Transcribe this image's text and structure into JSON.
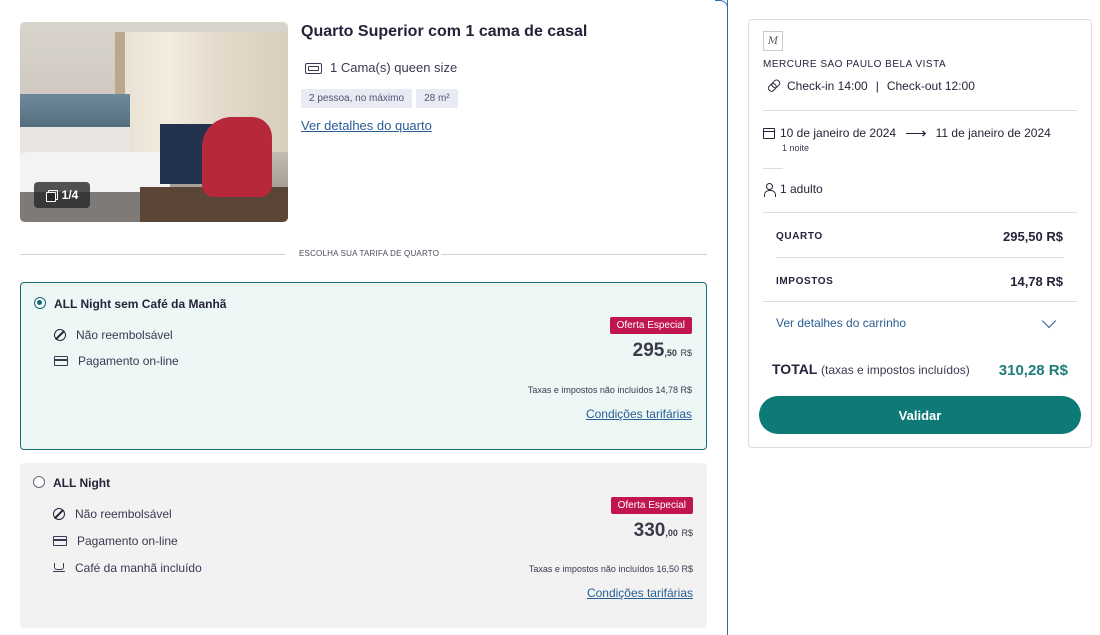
{
  "room": {
    "title": "Quarto Superior com 1 cama de casal",
    "bed": "1 Cama(s) queen size",
    "chips": [
      "2 pessoa, no máximo",
      "28 m²"
    ],
    "details_link": "Ver detalhes do quarto",
    "photo_counter": "1/4",
    "divider_label": "ESCOLHA SUA TARIFA DE QUARTO"
  },
  "rates": [
    {
      "name": "ALL Night sem Café da Manhã",
      "selected": true,
      "features": [
        "Não reembolsável",
        "Pagamento on-line"
      ],
      "badge": "Oferta Especial",
      "price_int": "295",
      "price_dec": ",50",
      "currency": "R$",
      "taxes_note": "Taxas e impostos não incluídos 14,78 R$",
      "conditions": "Condições tarifárias"
    },
    {
      "name": "ALL Night",
      "selected": false,
      "features": [
        "Não reembolsável",
        "Pagamento on-line",
        "Café da manhã incluído"
      ],
      "badge": "Oferta Especial",
      "price_int": "330",
      "price_dec": ",00",
      "currency": "R$",
      "taxes_note": "Taxas e impostos não incluídos 16,50 R$",
      "conditions": "Condições tarifárias"
    }
  ],
  "summary": {
    "logo": "M",
    "hotel_name": "MERCURE SAO PAULO BELA VISTA",
    "checkin": "Check-in 14:00",
    "separator": "|",
    "checkout": "Check-out 12:00",
    "date_from": "10 de janeiro de 2024",
    "date_arrow": "⟶",
    "date_to": "11 de janeiro de 2024",
    "nights": "1 noite",
    "guests": "1 adulto",
    "lines": [
      {
        "label": "QUARTO",
        "value": "295,50 R$"
      },
      {
        "label": "IMPOSTOS",
        "value": "14,78 R$"
      }
    ],
    "cart_link": "Ver detalhes do carrinho",
    "total_label": "TOTAL",
    "total_note": "(taxas e impostos incluídos)",
    "total_value": "310,28 R$",
    "validate_button": "Validar"
  },
  "colors": {
    "accent": "#0d7a77",
    "badge": "#c1154e",
    "link": "#2a5d93",
    "selected_border": "#1a6d74"
  }
}
